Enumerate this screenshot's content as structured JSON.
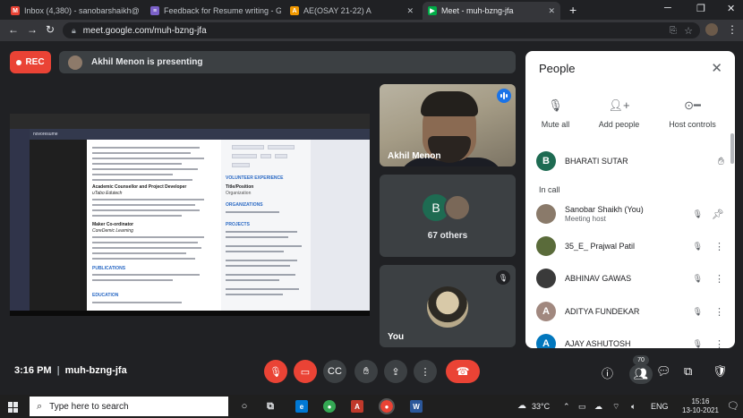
{
  "browser": {
    "tabs": [
      {
        "label": "Inbox (4,380) - sanobarshaikh@",
        "color": "#ea4335",
        "glyph": "M"
      },
      {
        "label": "Feedback for Resume writing - G",
        "color": "#7b61c9",
        "glyph": "≡"
      },
      {
        "label": "AE(OSAY 21-22) A",
        "color": "#f29900",
        "glyph": "A"
      },
      {
        "label": "Meet - muh-bzng-jfa",
        "color": "#00ac47",
        "glyph": "▶"
      }
    ],
    "url": "meet.google.com/muh-bzng-jfa"
  },
  "meet": {
    "rec_label": "REC",
    "presenting": "Akhil Menon is presenting",
    "tiles": {
      "speaker_name": "Akhil Menon",
      "others_initial": "B",
      "others_label": "67 others",
      "self_label": "You"
    },
    "shared_screen": {
      "resume_title": "Academic Counsellor and Project Developer",
      "resume_company": "uTabo Edutech",
      "resume_title2": "Maker Co-ordinator",
      "resume_company2": "CoreDemic Learning",
      "section_publications": "PUBLICATIONS",
      "section_education": "EDUCATION",
      "side_volunteer": "VOLUNTEER EXPERIENCE",
      "side_title": "Title/Position",
      "side_org": "Organization",
      "side_organizations": "ORGANIZATIONS",
      "side_projects": "PROJECTS",
      "app_name": "novoresume"
    },
    "time": "3:16 PM",
    "meeting_code": "muh-bzng-jfa",
    "participant_count": "70",
    "people": {
      "title": "People",
      "actions": [
        {
          "label": "Mute all",
          "icon": "mic-off-icon"
        },
        {
          "label": "Add people",
          "icon": "add-person-icon"
        },
        {
          "label": "Host controls",
          "icon": "toggle-icon"
        }
      ],
      "raised": {
        "initial": "B",
        "name": "BHARATI SUTAR",
        "color": "#1e6b52"
      },
      "in_call_label": "In call",
      "participants": [
        {
          "name": "Sanobar Shaikh (You)",
          "sub": "Meeting host",
          "initial": "",
          "color": "#8a7a6a"
        },
        {
          "name": "35_E_ Prajwal Patil",
          "sub": "",
          "initial": "",
          "color": "#5a6b3a"
        },
        {
          "name": "ABHINAV GAWAS",
          "sub": "",
          "initial": "",
          "color": "#3a3a3a"
        },
        {
          "name": "ADITYA FUNDEKAR",
          "sub": "",
          "initial": "A",
          "color": "#a1887f"
        },
        {
          "name": "AJAY ASHUTOSH",
          "sub": "",
          "initial": "A",
          "color": "#0277bd"
        }
      ]
    }
  },
  "taskbar": {
    "search_placeholder": "Type here to search",
    "weather": "33°C",
    "lang": "ENG",
    "clock_time": "15:16",
    "clock_date": "13-10-2021"
  }
}
